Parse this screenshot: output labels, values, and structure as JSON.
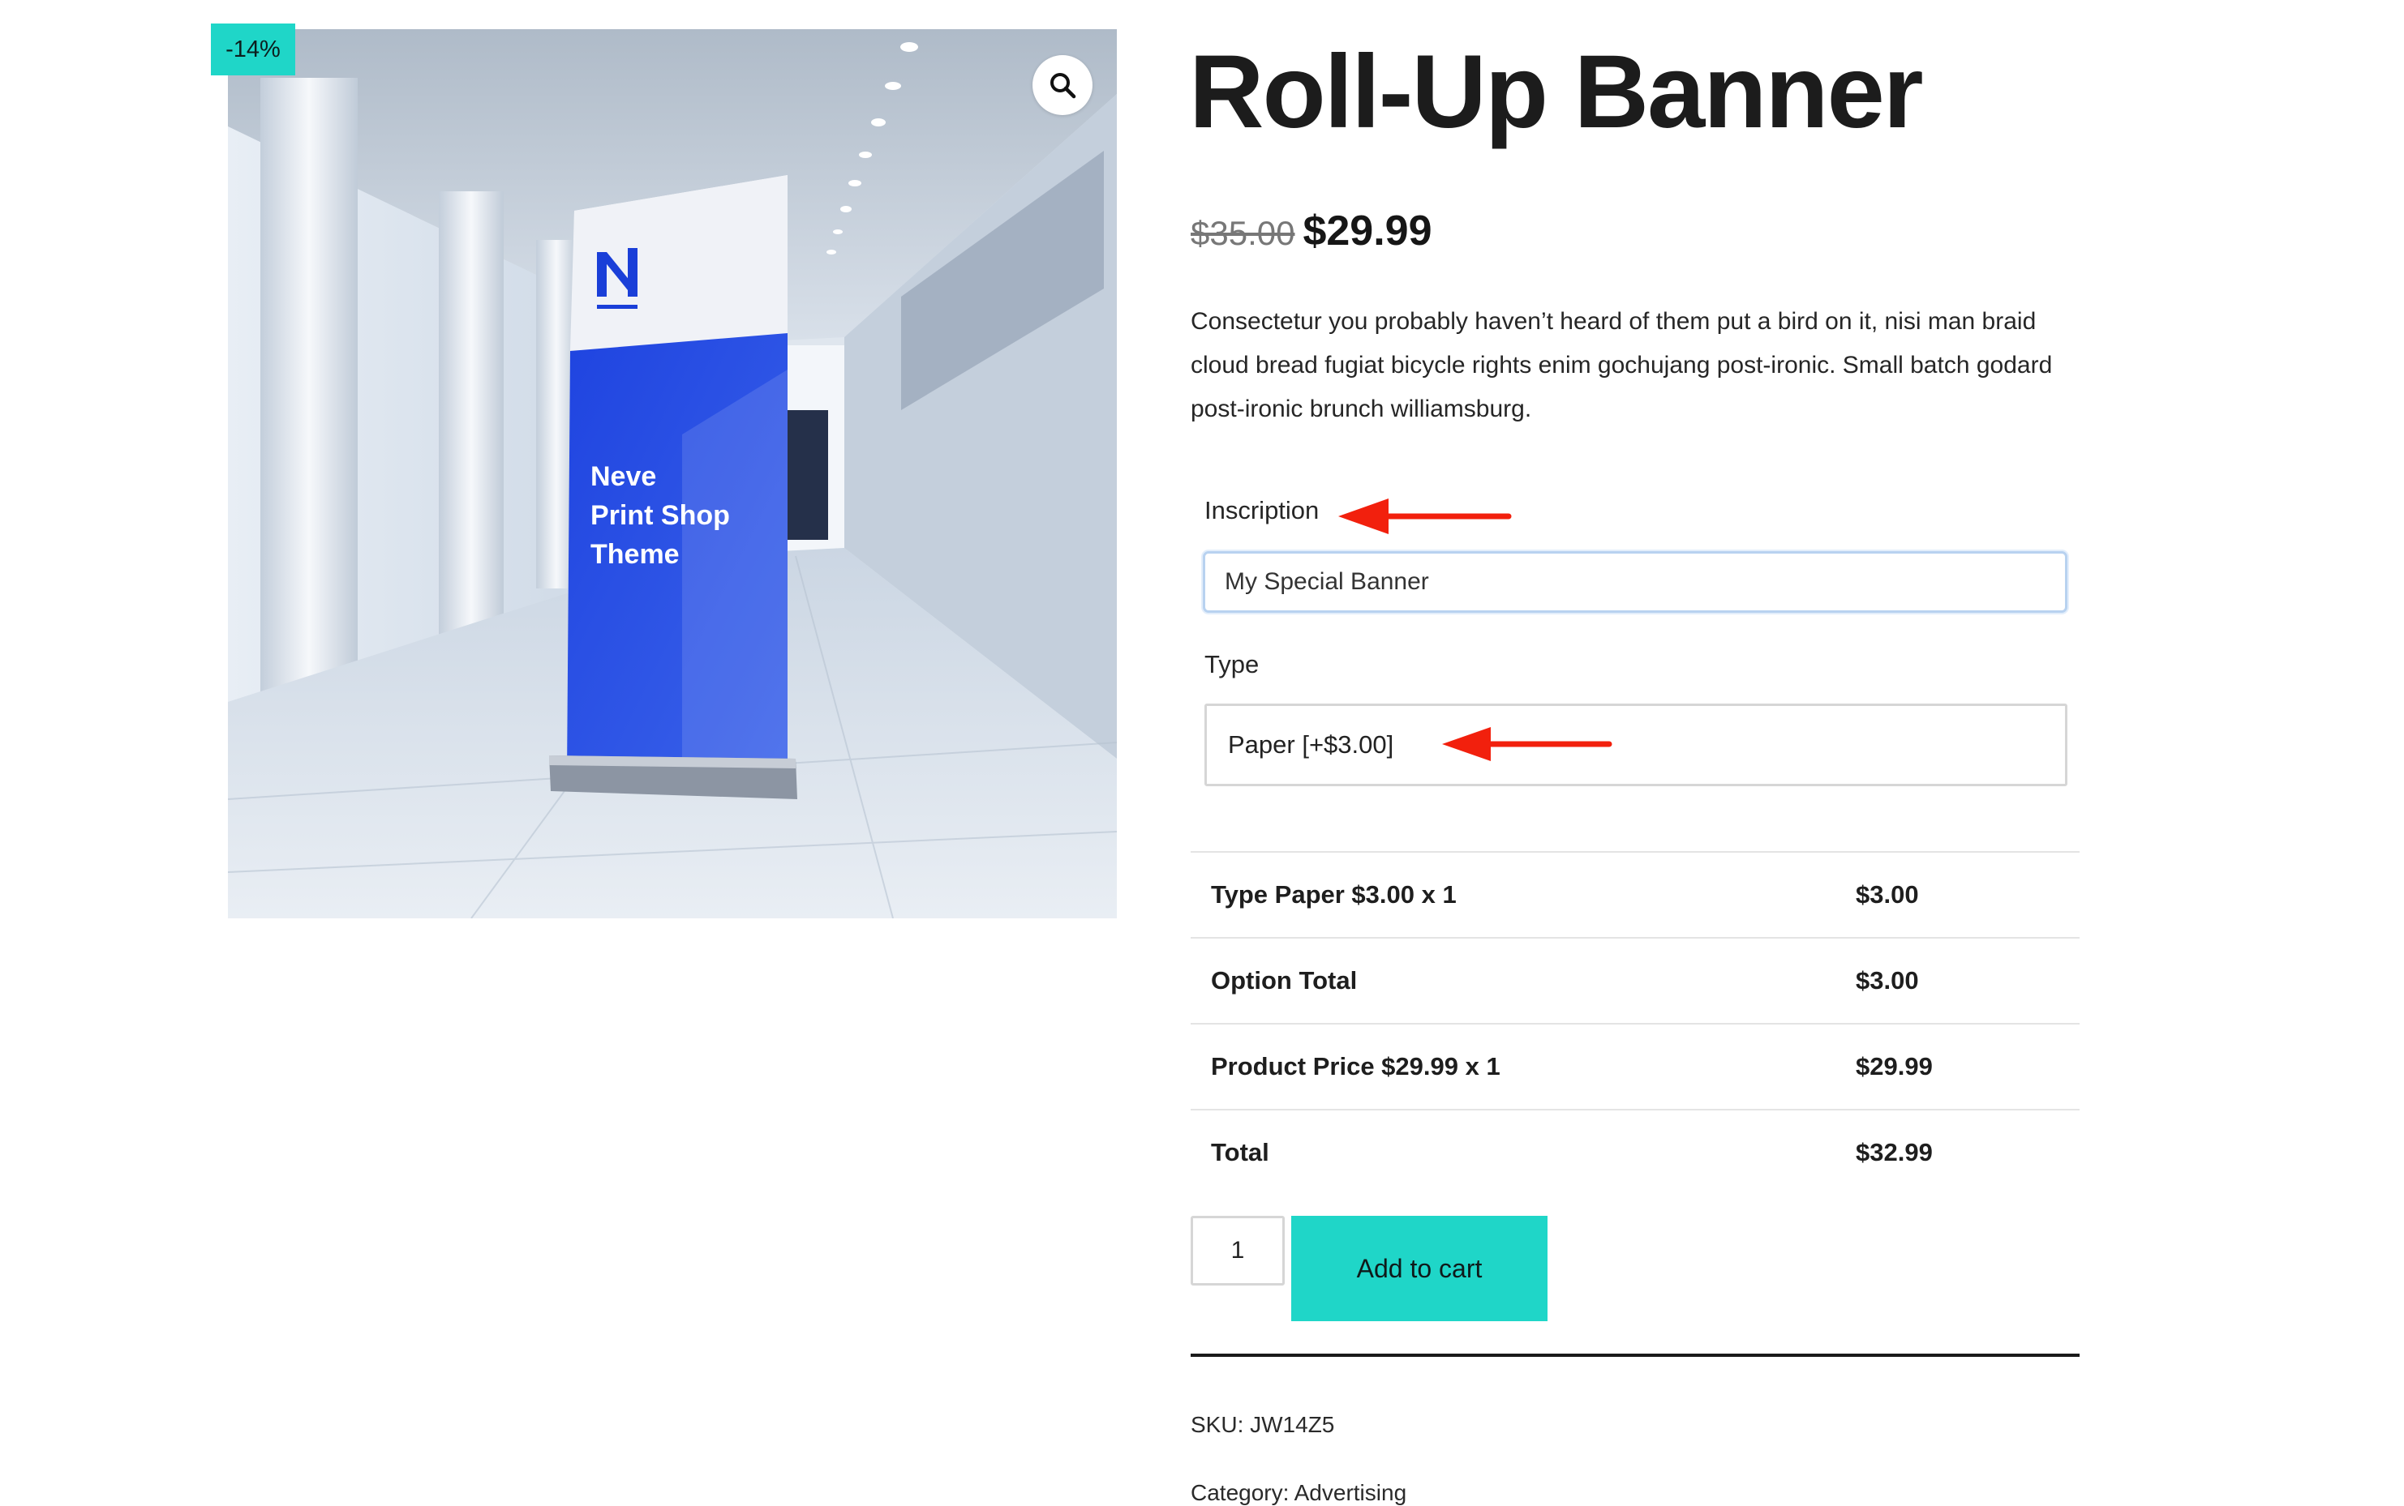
{
  "gallery": {
    "sale_badge": "-14%",
    "zoom_icon": "magnifier-icon",
    "banner_text": [
      "Neve",
      "Print Shop",
      "Theme"
    ],
    "banner_logo": "N",
    "brand_blue": "#1a3fd8"
  },
  "product": {
    "title": "Roll-Up Banner",
    "price_old": "$35.00",
    "price_new": "$29.99",
    "description": "Consectetur you probably haven’t heard of them put a bird on it, nisi man braid cloud bread fugiat bicycle rights enim gochujang post-ironic. Small batch godard post-ironic brunch williamsburg."
  },
  "options": {
    "inscription_label": "Inscription",
    "inscription_value": "My Special Banner",
    "type_label": "Type",
    "type_value": "Paper [+$3.00]"
  },
  "totals": [
    {
      "label": "Type Paper $3.00 x 1",
      "value": "$3.00"
    },
    {
      "label": "Option Total",
      "value": "$3.00"
    },
    {
      "label": "Product Price $29.99 x 1",
      "value": "$29.99"
    },
    {
      "label": "Total",
      "value": "$32.99"
    }
  ],
  "cart": {
    "quantity": "1",
    "add_to_cart_label": "Add to cart"
  },
  "meta": {
    "sku": "SKU: JW14Z5",
    "categories": "Category: Advertising"
  },
  "colors": {
    "accent": "#1fd6c8",
    "arrow": "#f2200d"
  }
}
